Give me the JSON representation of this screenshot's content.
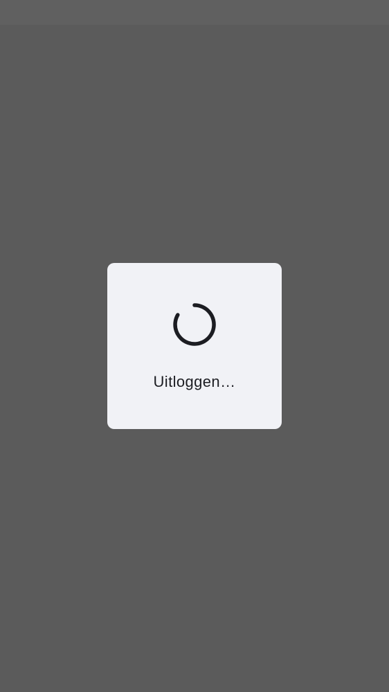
{
  "dialog": {
    "message": "Uitloggen…"
  },
  "icons": {
    "spinner": "progress-spinner-icon"
  },
  "colors": {
    "scrim": "#5b5b5b",
    "dialog_background": "#f1f2f6",
    "spinner": "#1c1d22",
    "text": "#1c1d22"
  }
}
